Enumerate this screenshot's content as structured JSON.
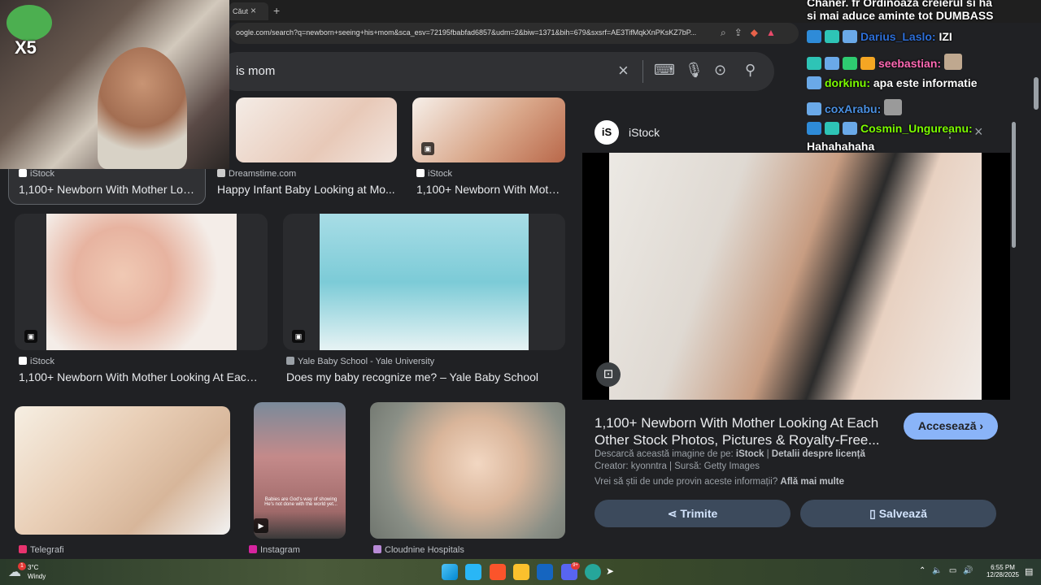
{
  "browser": {
    "tab_label": "Căut",
    "tab_close": "×",
    "tab_new": "+",
    "url": "oogle.com/search?q=newborn+seeing+his+mom&sca_esv=72195fbabfad6857&udm=2&biw=1371&bih=679&sxsrf=AE3TifMqkXnPKsKZ7bP..."
  },
  "search": {
    "query_visible": "is mom",
    "clear_icon": "×"
  },
  "results": {
    "row1": [
      {
        "source": "iStock",
        "title": "1,100+ Newborn With Mother Loo..."
      },
      {
        "source": "Dreamstime.com",
        "title": "Happy Infant Baby Looking at Mo..."
      },
      {
        "source": "iStock",
        "title": "1,100+ Newborn With Moth..."
      }
    ],
    "row2": [
      {
        "source": "iStock",
        "title": "1,100+ Newborn With Mother Looking At Each ..."
      },
      {
        "source": "Yale Baby School - Yale University",
        "title": "Does my baby recognize me? – Yale Baby School"
      }
    ],
    "row3_sources": [
      "Telegrafi",
      "Instagram",
      "Cloudnine Hospitals"
    ],
    "instagram_caption": "Babies are God's way of showing He's not done with the world yet..."
  },
  "panel": {
    "source": "iStock",
    "title_line1": "1,100+ Newborn With Mother Looking At Each",
    "title_line2": "Other Stock Photos, Pictures & Royalty-Free...",
    "visit_label": "Accesează ›",
    "download_prefix": "Descarcă această imagine de pe: ",
    "download_source": "iStock",
    "license_link": "Detalii despre licență",
    "creator_line": "Creator: kyonntra | Sursă: Getty Images",
    "info_prefix": "Vrei să știi de unde provin aceste informații? ",
    "info_link": "Află mai multe",
    "share_label": "Trimite",
    "save_label": "Salvează"
  },
  "overlay": {
    "multiplier": "X5",
    "chat_top1": "Chaner. fr Ordinoaza creierul si ha",
    "chat_top2": "si mai aduce aminte tot DUMBASS",
    "messages": [
      {
        "user": "Darius_Laslo:",
        "text": "IZI",
        "user_color": "#2e6fd8"
      },
      {
        "user": "seebastian:",
        "text": "",
        "user_color": "#ff69b4"
      },
      {
        "user": "dorkinu:",
        "text": "apa este informatie",
        "user_color": "#7cfc00"
      },
      {
        "user": "coxArabu:",
        "text": "",
        "user_color": "#4a90e2"
      },
      {
        "user": "Cosmin_Ungureanu:",
        "text": "Hahahahaha",
        "user_color": "#7cfc00"
      }
    ]
  },
  "taskbar": {
    "weather_temp": "3°C",
    "weather_desc": "Windy",
    "weather_badge": "1",
    "discord_badge": "9+",
    "time": "6:55 PM",
    "date": "12/28/2025"
  },
  "colors": {
    "accent": "#8ab4f8",
    "visit_button": "#8ab4f8",
    "page_bg": "#202124"
  }
}
